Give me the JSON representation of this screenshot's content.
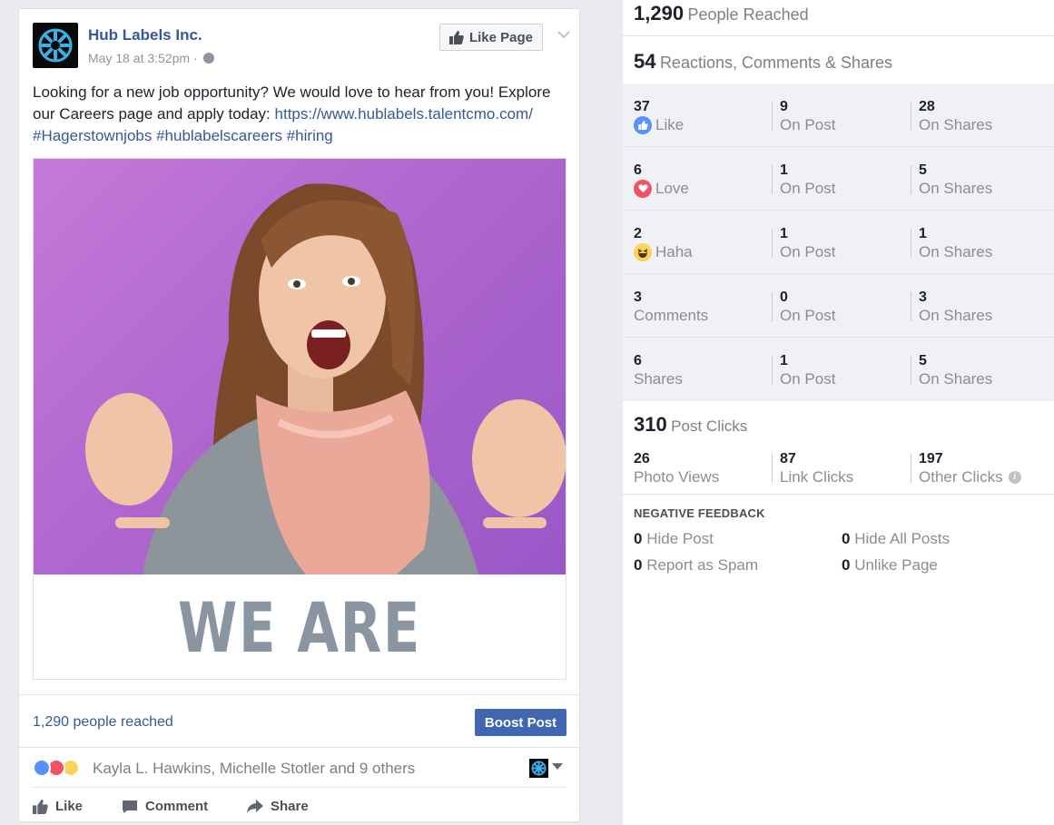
{
  "post": {
    "page_name": "Hub Labels Inc.",
    "date": "May 18 at 3:52pm",
    "date_sep": "·",
    "like_page_label": "Like Page",
    "text_line1": "Looking for a new job opportunity? We would love to hear from you! Explore our Careers page and apply today: ",
    "link": "https://www.hublabels.talentcmo.com/",
    "hashtags": "#Hagerstownjobs #hublabelscareers #hiring",
    "image_banner": "WE ARE HIRING!",
    "reached_label": "1,290 people reached",
    "boost_label": "Boost Post",
    "reactors_text": "Kayla L. Hawkins, Michelle Stotler and 9 others",
    "actions": {
      "like": "Like",
      "comment": "Comment",
      "share": "Share"
    }
  },
  "stats": {
    "people_reached": {
      "num": "1,290",
      "label": "People Reached"
    },
    "engagement": {
      "num": "54",
      "label": "Reactions, Comments & Shares"
    },
    "rows": [
      {
        "total": "37",
        "label": "Like",
        "on_post": "9",
        "on_post_label": "On Post",
        "on_shares": "28",
        "on_shares_label": "On Shares"
      },
      {
        "total": "6",
        "label": "Love",
        "on_post": "1",
        "on_post_label": "On Post",
        "on_shares": "5",
        "on_shares_label": "On Shares"
      },
      {
        "total": "2",
        "label": "Haha",
        "on_post": "1",
        "on_post_label": "On Post",
        "on_shares": "1",
        "on_shares_label": "On Shares"
      },
      {
        "total": "3",
        "label": "Comments",
        "on_post": "0",
        "on_post_label": "On Post",
        "on_shares": "3",
        "on_shares_label": "On Shares"
      },
      {
        "total": "6",
        "label": "Shares",
        "on_post": "1",
        "on_post_label": "On Post",
        "on_shares": "5",
        "on_shares_label": "On Shares"
      }
    ],
    "post_clicks": {
      "num": "310",
      "label": "Post Clicks"
    },
    "clicks": [
      {
        "num": "26",
        "label": "Photo Views"
      },
      {
        "num": "87",
        "label": "Link Clicks"
      },
      {
        "num": "197",
        "label": "Other Clicks"
      }
    ],
    "negative_title": "NEGATIVE FEEDBACK",
    "negative": [
      {
        "num": "0",
        "label": "Hide Post"
      },
      {
        "num": "0",
        "label": "Hide All Posts"
      },
      {
        "num": "0",
        "label": "Report as Spam"
      },
      {
        "num": "0",
        "label": "Unlike Page"
      }
    ],
    "info_glyph": "i"
  },
  "colors": {
    "fb_blue": "#4267b2",
    "link": "#365899",
    "like_blue": "#5890ff",
    "love_red": "#f25268",
    "haha_yellow": "#fdd35c"
  }
}
